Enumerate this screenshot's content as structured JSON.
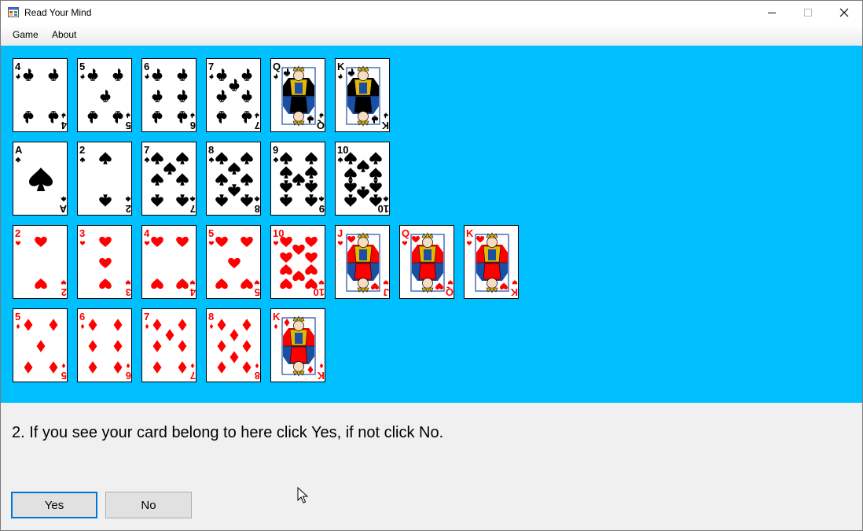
{
  "window": {
    "title": "Read Your Mind",
    "controls": [
      "minimize",
      "maximize",
      "close"
    ]
  },
  "menu": {
    "items": [
      "Game",
      "About"
    ]
  },
  "colors": {
    "felt": "#00bfff",
    "red_suit": "#ff0000",
    "black_suit": "#000000",
    "court_gold": "#e6b800",
    "court_blue": "#1a4fa3"
  },
  "cards": [
    [
      {
        "rank": "4",
        "suit": "clubs"
      },
      {
        "rank": "5",
        "suit": "clubs"
      },
      {
        "rank": "6",
        "suit": "clubs"
      },
      {
        "rank": "7",
        "suit": "clubs"
      },
      {
        "rank": "Q",
        "suit": "clubs"
      },
      {
        "rank": "K",
        "suit": "clubs"
      }
    ],
    [
      {
        "rank": "A",
        "suit": "spades"
      },
      {
        "rank": "2",
        "suit": "spades"
      },
      {
        "rank": "7",
        "suit": "spades"
      },
      {
        "rank": "8",
        "suit": "spades"
      },
      {
        "rank": "9",
        "suit": "spades"
      },
      {
        "rank": "10",
        "suit": "spades"
      }
    ],
    [
      {
        "rank": "2",
        "suit": "hearts"
      },
      {
        "rank": "3",
        "suit": "hearts"
      },
      {
        "rank": "4",
        "suit": "hearts"
      },
      {
        "rank": "5",
        "suit": "hearts"
      },
      {
        "rank": "10",
        "suit": "hearts"
      },
      {
        "rank": "J",
        "suit": "hearts"
      },
      {
        "rank": "Q",
        "suit": "hearts"
      },
      {
        "rank": "K",
        "suit": "hearts"
      }
    ],
    [
      {
        "rank": "5",
        "suit": "diamonds"
      },
      {
        "rank": "6",
        "suit": "diamonds"
      },
      {
        "rank": "7",
        "suit": "diamonds"
      },
      {
        "rank": "8",
        "suit": "diamonds"
      },
      {
        "rank": "K",
        "suit": "diamonds"
      }
    ]
  ],
  "instruction": "2. If you see your card belong to here click Yes, if not click No.",
  "buttons": {
    "yes": "Yes",
    "no": "No"
  }
}
